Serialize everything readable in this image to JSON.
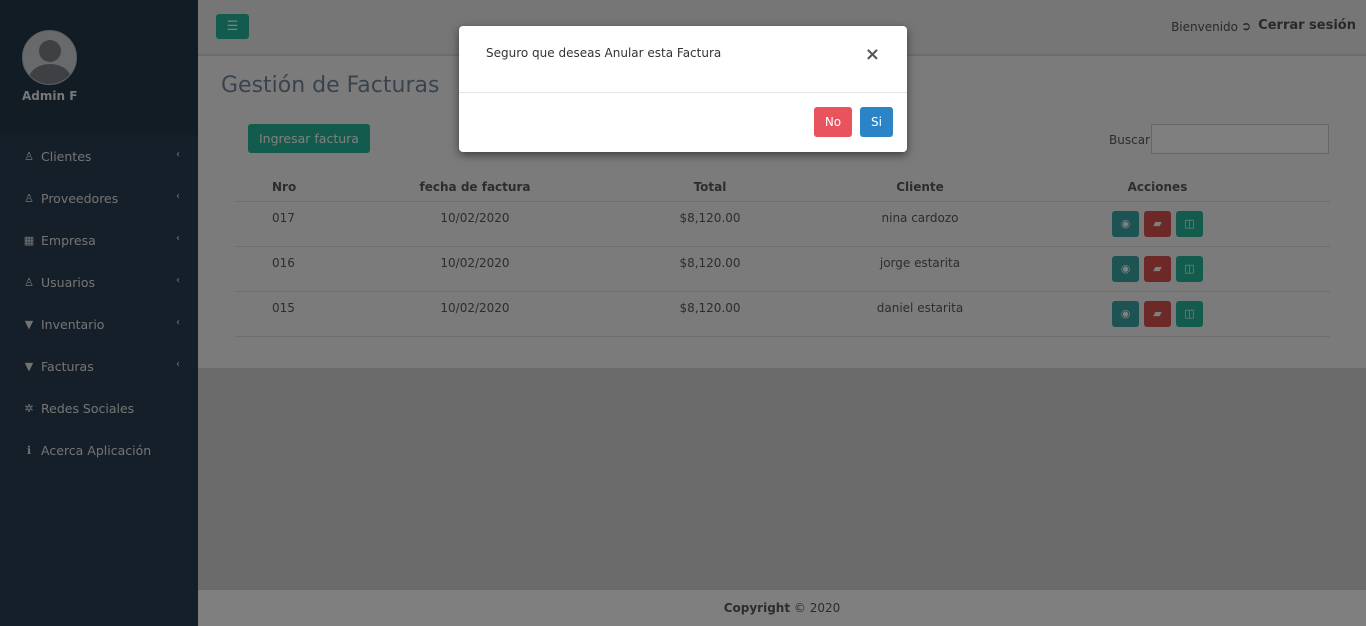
{
  "sidebar": {
    "user_name": "Admin F",
    "items": [
      {
        "label": "Clientes",
        "icon": "user-icon",
        "glyph": "♙",
        "has_submenu": true
      },
      {
        "label": "Proveedores",
        "icon": "user-icon",
        "glyph": "♙",
        "has_submenu": true
      },
      {
        "label": "Empresa",
        "icon": "building-icon",
        "glyph": "▦",
        "has_submenu": true
      },
      {
        "label": "Usuarios",
        "icon": "user-icon",
        "glyph": "♙",
        "has_submenu": true
      },
      {
        "label": "Inventario",
        "icon": "cart-icon",
        "glyph": "▼",
        "has_submenu": true
      },
      {
        "label": "Facturas",
        "icon": "cart-icon",
        "glyph": "▼",
        "has_submenu": true
      },
      {
        "label": "Redes Sociales",
        "icon": "gear-icon",
        "glyph": "✲",
        "has_submenu": false
      },
      {
        "label": "Acerca Aplicación",
        "icon": "info-icon",
        "glyph": "ℹ",
        "has_submenu": false
      }
    ]
  },
  "topbar": {
    "welcome": "Bienvenido",
    "logout_label": "Cerrar sesión"
  },
  "page": {
    "title": "Gestión de Facturas",
    "add_button": "Ingresar factura",
    "search_label": "Buscar",
    "search_value": ""
  },
  "table": {
    "headers": [
      "Nro",
      "fecha de factura",
      "Total",
      "Cliente",
      "Acciones"
    ],
    "rows": [
      {
        "nro": "017",
        "fecha": "10/02/2020",
        "total": "$8,120.00",
        "cliente": "nina cardozo"
      },
      {
        "nro": "016",
        "fecha": "10/02/2020",
        "total": "$8,120.00",
        "cliente": "jorge estarita"
      },
      {
        "nro": "015",
        "fecha": "10/02/2020",
        "total": "$8,120.00",
        "cliente": "daniel estarita"
      }
    ]
  },
  "footer": {
    "bold": "Copyright",
    "rest": " © 2020"
  },
  "modal": {
    "message": "Seguro que deseas Anular esta Factura",
    "close": "×",
    "no_label": "No",
    "yes_label": "Si"
  },
  "colors": {
    "sidebar": "#2a3f54",
    "primary_green": "#26b99a",
    "danger": "#d9534f",
    "btn_no": "#e9535d",
    "btn_si": "#2a84c5"
  }
}
